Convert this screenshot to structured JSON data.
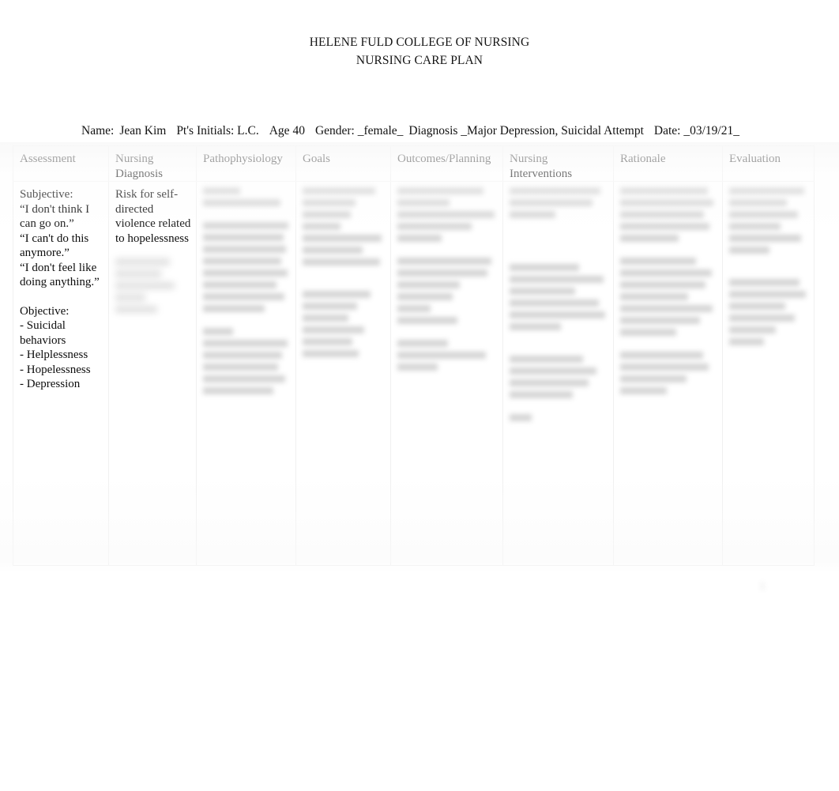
{
  "document": {
    "title_line_1": "HELENE FULD COLLEGE OF NURSING",
    "title_line_2": "NURSING CARE PLAN"
  },
  "patient_info": {
    "name_label": "Name:",
    "name_value": "Jean Kim",
    "initials_label": "Pt's Initials:",
    "initials_value": "L.C.",
    "age_label": "Age",
    "age_value": "40",
    "gender_label": "Gender:",
    "gender_value": "_female_",
    "diagnosis_label": "Diagnosis",
    "diagnosis_value": "_Major Depression, Suicidal Attempt",
    "date_label": "Date:",
    "date_value": "_03/19/21_"
  },
  "table": {
    "headers": [
      "Assessment",
      "Nursing Diagnosis",
      "Pathophysiology",
      "Goals",
      "Outcomes/Planning",
      "Nursing Interventions",
      "Rationale",
      "Evaluation"
    ],
    "assessment": {
      "subjective_label": "Subjective:",
      "quote_1": "“I don't think I can go on.”",
      "quote_2": "“I can't do this anymore.”",
      "quote_3": "“I don't feel like doing anything.”",
      "objective_label": "Objective:",
      "objective_1": "- Suicidal behaviors",
      "objective_2": "- Helplessness",
      "objective_3": "- Hopelessness",
      "objective_4": "- Depression"
    },
    "nursing_diagnosis": {
      "text": "Risk for self-directed violence related to hopelessness",
      "redacted_block": "redacted text block"
    },
    "pathophysiology": {
      "redacted_block_1": "redacted text block",
      "redacted_block_2": "redacted text block",
      "redacted_block_3": "redacted text block"
    },
    "goals": {
      "redacted_block_1": "redacted text block",
      "redacted_block_2": "redacted text block"
    },
    "outcomes_planning": {
      "redacted_block_1": "redacted text block",
      "redacted_block_2": "redacted text block",
      "redacted_block_3": "redacted text block"
    },
    "nursing_interventions": {
      "redacted_block_1": "redacted text block",
      "redacted_block_2": "redacted text block",
      "redacted_block_3": "redacted text block"
    },
    "rationale": {
      "redacted_block_1": "redacted text block",
      "redacted_block_2": "redacted text block",
      "redacted_block_3": "redacted text block"
    },
    "evaluation": {
      "redacted_block_1": "redacted text block",
      "redacted_block_2": "redacted text block"
    }
  },
  "page_mark": "1"
}
